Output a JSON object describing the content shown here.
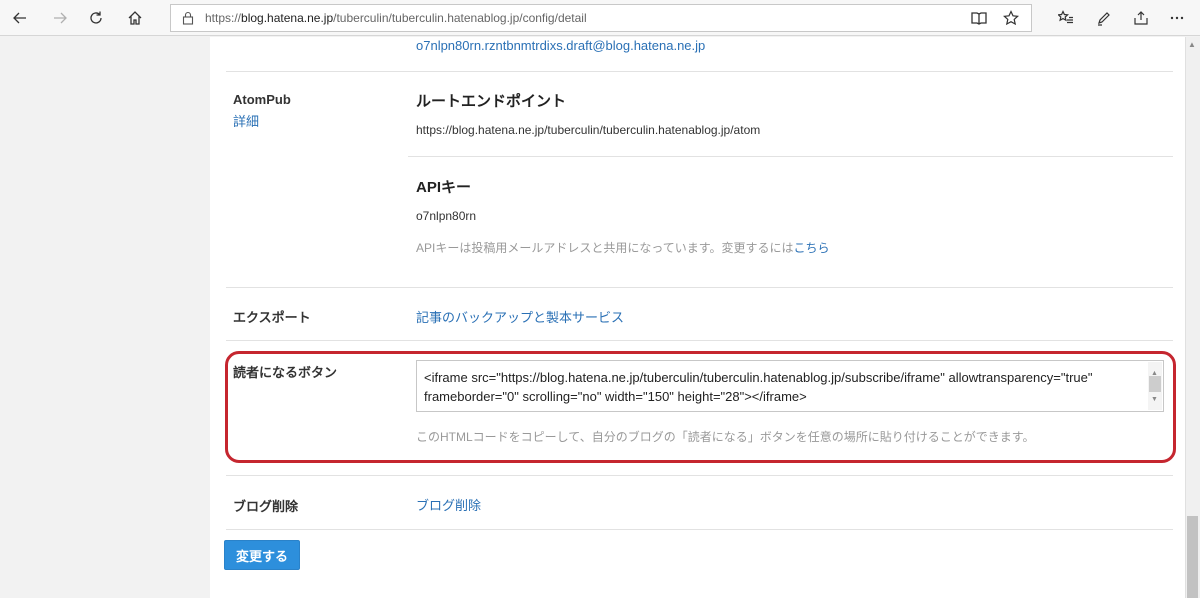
{
  "browser": {
    "url_prefix": "https://",
    "url_host": "blog.hatena.ne.jp",
    "url_path": "/tuberculin/tuberculin.hatenablog.jp/config/detail"
  },
  "mail": {
    "draft_address": "o7nlpn80rn.rzntbnmtrdixs.draft@blog.hatena.ne.jp"
  },
  "atompub": {
    "label": "AtomPub",
    "detail_link": "詳細",
    "root_heading": "ルートエンドポイント",
    "root_url": "https://blog.hatena.ne.jp/tuberculin/tuberculin.hatenablog.jp/atom",
    "api_heading": "APIキー",
    "api_key": "o7nlpn80rn",
    "api_note": "APIキーは投稿用メールアドレスと共用になっています。変更するには",
    "api_note_link": "こちら"
  },
  "export": {
    "label": "エクスポート",
    "link": "記事のバックアップと製本サービス"
  },
  "subscribe": {
    "label": "読者になるボタン",
    "code_line1": "<iframe src=\"https://blog.hatena.ne.jp/tuberculin/tuberculin.hatenablog.jp/subscribe/iframe\" allowtransparency=\"true\"",
    "code_line2": "frameborder=\"0\" scrolling=\"no\" width=\"150\" height=\"28\"></iframe>",
    "note": "このHTMLコードをコピーして、自分のブログの「読者になる」ボタンを任意の場所に貼り付けることができます。"
  },
  "delete": {
    "label": "ブログ削除",
    "link": "ブログ削除"
  },
  "submit_label": "変更する"
}
